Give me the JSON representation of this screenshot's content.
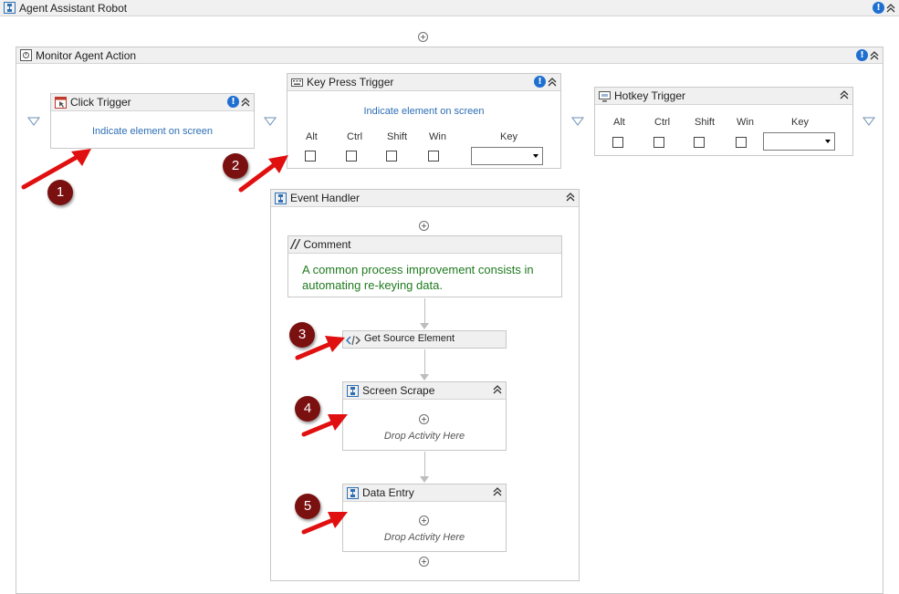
{
  "workflow": {
    "root_title": "Agent Assistant Robot",
    "monitor_title": "Monitor Agent Action",
    "click_trigger": {
      "title": "Click Trigger",
      "indicate_link": "Indicate element on screen"
    },
    "key_press_trigger": {
      "title": "Key Press Trigger",
      "indicate_link": "Indicate element on screen",
      "modifiers": [
        "Alt",
        "Ctrl",
        "Shift",
        "Win"
      ],
      "key_label": "Key",
      "key_value": ""
    },
    "hotkey_trigger": {
      "title": "Hotkey Trigger",
      "modifiers": [
        "Alt",
        "Ctrl",
        "Shift",
        "Win"
      ],
      "key_label": "Key",
      "key_value": ""
    },
    "event_handler": {
      "title": "Event Handler",
      "comment": {
        "title": "Comment",
        "text": "A common process improvement consists in automating re-keying data."
      },
      "get_source_element": "Get Source Element",
      "screen_scrape": {
        "title": "Screen Scrape",
        "drop_text": "Drop Activity Here"
      },
      "data_entry": {
        "title": "Data Entry",
        "drop_text": "Drop Activity Here"
      }
    }
  },
  "annotations": [
    "1",
    "2",
    "3",
    "4",
    "5"
  ],
  "colors": {
    "header_bg": "#f0f0f0",
    "border": "#c8c8c8",
    "link": "#2e6fb5",
    "comment_text": "#1f7a1f",
    "info_blue": "#1f6fd1",
    "badge": "#7a1010",
    "arrow_red": "#e01010"
  }
}
